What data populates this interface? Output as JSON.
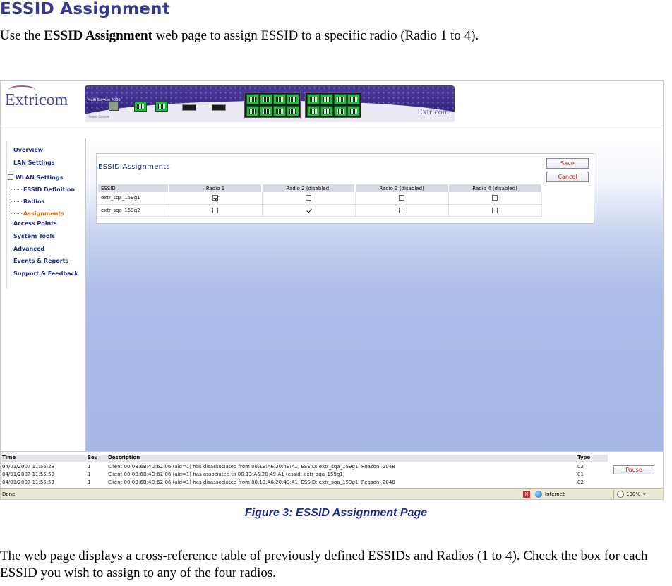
{
  "doc": {
    "heading": "ESSID Assignment",
    "intro_pre": "Use the ",
    "intro_bold": "ESSID Assignment",
    "intro_post": " web page to assign ESSID to a specific radio (Radio 1 to 4).",
    "caption": "Figure 3: ESSID Assignment Page",
    "body": "The web page displays a cross-reference table of previously defined ESSIDs and Radios (1 to 4). Check the box for each ESSID you wish to assign to any of the four radios."
  },
  "banner": {
    "logo": "Extricom",
    "device_model": "Multi Service 4000",
    "device_sub": "Power    Console",
    "device_brand": "Extricom"
  },
  "sidebar": {
    "items": [
      {
        "label": "Overview"
      },
      {
        "label": "LAN Settings"
      },
      {
        "label": "WLAN Settings"
      },
      {
        "label": "ESSID Definition"
      },
      {
        "label": "Radios"
      },
      {
        "label": "Assignments",
        "active": true
      },
      {
        "label": "Access Points"
      },
      {
        "label": "System Tools"
      },
      {
        "label": "Advanced"
      },
      {
        "label": "Events & Reports"
      },
      {
        "label": "Support & Feedback"
      }
    ]
  },
  "panel": {
    "title": "ESSID Assignments",
    "headers": [
      "ESSID",
      "Radio 1",
      "Radio 2 (disabled)",
      "Radio 3 (disabled)",
      "Radio 4 (disabled)"
    ],
    "rows": [
      {
        "essid": "extr_sqa_159g1",
        "checks": [
          true,
          false,
          false,
          false
        ]
      },
      {
        "essid": "extr_sqa_159g2",
        "checks": [
          false,
          true,
          false,
          false
        ]
      }
    ],
    "save_label": "Save",
    "cancel_label": "Cancel"
  },
  "log": {
    "headers": {
      "time": "Time",
      "sev": "Sev",
      "desc": "Description",
      "type": "Type"
    },
    "rows": [
      {
        "time": "04/01/2007 11:56:28",
        "sev": "1",
        "desc": "Client 00:0B:6B:4D:62:06 (aid=1) has disassociated from 00:13:A6:20:49:A1, ESSID: extr_sqa_159g1, Reason: 2048",
        "type": "02"
      },
      {
        "time": "04/01/2007 11:55:59",
        "sev": "1",
        "desc": "Client 00:0B:6B:4D:62:06 (aid=1) has associated to 00:13:A6:20:49:A1 (essid: extr_sqa_159g1)",
        "type": "01"
      },
      {
        "time": "04/01/2007 11:55:53",
        "sev": "1",
        "desc": "Client 00:0B:6B:4D:62:06 (aid=1) has disassociated from 00:13:A6:20:49:A1, ESSID: extr_sqa_159g1, Reason: 2048",
        "type": "02"
      }
    ],
    "pause_label": "Pause"
  },
  "statusbar": {
    "status": "Done",
    "zone": "Internet",
    "zoom": "100%",
    "zoom_arrow": "▾"
  }
}
